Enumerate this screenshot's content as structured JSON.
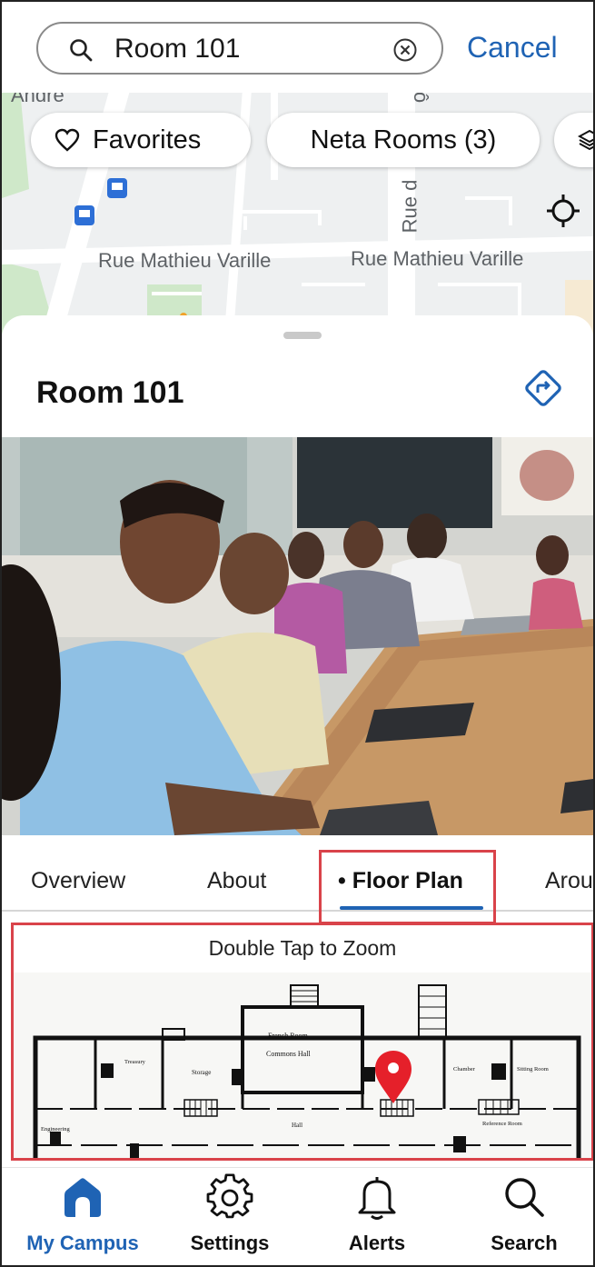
{
  "search": {
    "value": "Room 101",
    "cancel_label": "Cancel"
  },
  "map": {
    "chips": [
      {
        "label": "Favorites",
        "icon": "heart-icon"
      },
      {
        "label": "Neta Rooms (3)"
      },
      {
        "icon": "layers-icon"
      }
    ],
    "road_labels": {
      "road_1": "Rue Mathieu Varille",
      "road_2": "Rue Mathieu Varille",
      "road_vertical": "Rue d",
      "top_left": "Andre",
      "top_mid": "ô"
    }
  },
  "sheet": {
    "title": "Room 101",
    "tabs": [
      {
        "label": "Overview"
      },
      {
        "label": "About"
      },
      {
        "label": "• Floor Plan",
        "selected": true
      },
      {
        "label": "Arou"
      }
    ],
    "floor_plan": {
      "hint": "Double Tap to Zoom",
      "room_labels": {
        "a": "French Room",
        "b": "Commons Hall",
        "c": "Hall",
        "d": "Storage",
        "e": "Sitting Room",
        "f": "Chamber",
        "g": "Engineering",
        "h": "Reference Room",
        "i": "Treasury"
      }
    }
  },
  "bottom_nav": [
    {
      "label": "My Campus",
      "icon": "home-icon",
      "active": true
    },
    {
      "label": "Settings",
      "icon": "gear-icon"
    },
    {
      "label": "Alerts",
      "icon": "bell-icon"
    },
    {
      "label": "Search",
      "icon": "search-icon"
    }
  ],
  "colors": {
    "accent": "#1f63b4",
    "highlight": "#d9434a",
    "pin": "#e5202a"
  }
}
